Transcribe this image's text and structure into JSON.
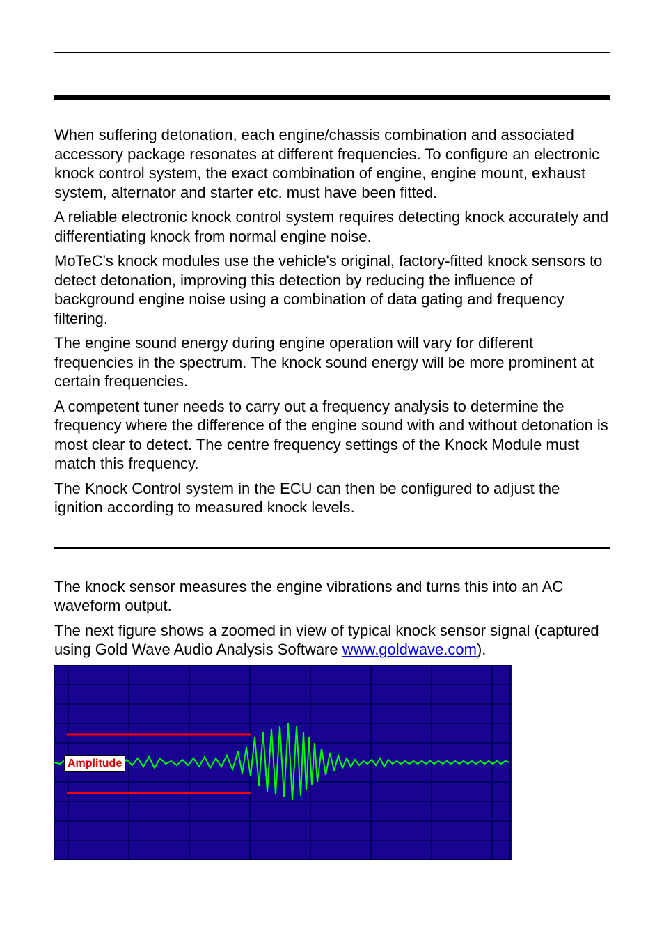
{
  "paragraphs": {
    "p1": "When suffering detonation, each engine/chassis combination and associated accessory package resonates at different frequencies. To configure an electronic knock control system, the exact combination of engine, engine mount, exhaust system, alternator and starter etc. must have been fitted.",
    "p2": "A reliable electronic knock control system requires detecting knock accurately and differentiating knock from normal engine noise.",
    "p3": "MoTeC's knock modules use the vehicle's original, factory-fitted knock sensors to detect detonation, improving this detection by reducing the influence of background engine noise using a combination of data gating and frequency filtering.",
    "p4": "The engine sound energy during engine operation will vary for different frequencies in the spectrum. The knock sound energy will be more prominent at certain frequencies.",
    "p5": "A competent tuner needs to carry out a frequency analysis to determine the frequency where the difference of the engine sound with and without detonation is most clear to detect. The centre frequency settings of the Knock Module must match this frequency.",
    "p6": "The Knock Control system in the ECU can then be configured to adjust the ignition according to measured knock levels.",
    "p7": "The knock sensor measures the engine vibrations and turns this into an AC waveform output.",
    "p8a": "The next figure shows a zoomed in view of typical knock sensor signal (captured using Gold Wave Audio Analysis Software ",
    "p8b": ").",
    "link_text": "www.goldwave.com",
    "link_href": "http://www.goldwave.com"
  },
  "waveform": {
    "amplitude_label": "Amplitude"
  }
}
